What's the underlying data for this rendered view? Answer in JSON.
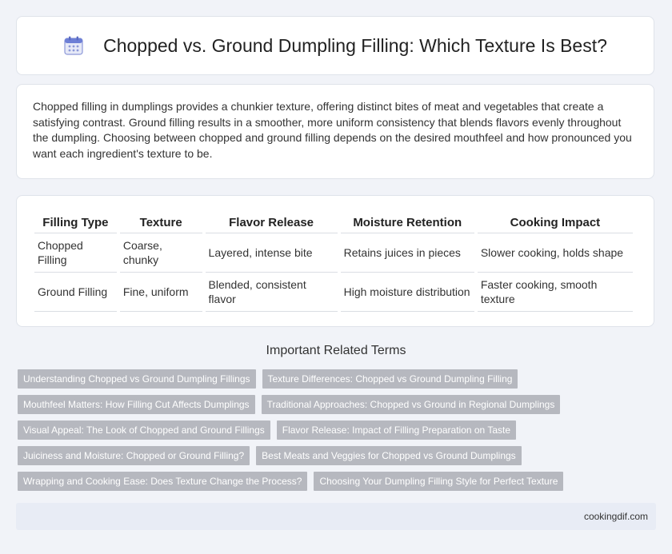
{
  "header": {
    "title": "Chopped vs. Ground Dumpling Filling: Which Texture Is Best?",
    "icon": "calendar-icon"
  },
  "intro": {
    "text": "Chopped filling in dumplings provides a chunkier texture, offering distinct bites of meat and vegetables that create a satisfying contrast. Ground filling results in a smoother, more uniform consistency that blends flavors evenly throughout the dumpling. Choosing between chopped and ground filling depends on the desired mouthfeel and how pronounced you want each ingredient's texture to be."
  },
  "table": {
    "headers": [
      "Filling Type",
      "Texture",
      "Flavor Release",
      "Moisture Retention",
      "Cooking Impact"
    ],
    "rows": [
      [
        "Chopped Filling",
        "Coarse, chunky",
        "Layered, intense bite",
        "Retains juices in pieces",
        "Slower cooking, holds shape"
      ],
      [
        "Ground Filling",
        "Fine, uniform",
        "Blended, consistent flavor",
        "High moisture distribution",
        "Faster cooking, smooth texture"
      ]
    ]
  },
  "related": {
    "title": "Important Related Terms",
    "tags": [
      [
        "Understanding Chopped vs Ground Dumpling Fillings",
        "Texture Differences: Chopped vs Ground Dumpling Filling"
      ],
      [
        "Mouthfeel Matters: How Filling Cut Affects Dumplings",
        "Traditional Approaches: Chopped vs Ground in Regional Dumplings"
      ],
      [
        "Visual Appeal: The Look of Chopped and Ground Fillings",
        "Flavor Release: Impact of Filling Preparation on Taste"
      ],
      [
        "Juiciness and Moisture: Chopped or Ground Filling?",
        "Best Meats and Veggies for Chopped vs Ground Dumplings"
      ],
      [
        "Wrapping and Cooking Ease: Does Texture Change the Process?",
        "Choosing Your Dumpling Filling Style for Perfect Texture"
      ]
    ]
  },
  "footer": {
    "site": "cookingdif.com"
  },
  "colors": {
    "background": "#f1f3f8",
    "tag": "#b6b8bf",
    "footer": "#e8ecf5",
    "icon_accent": "#6d7fd6"
  }
}
